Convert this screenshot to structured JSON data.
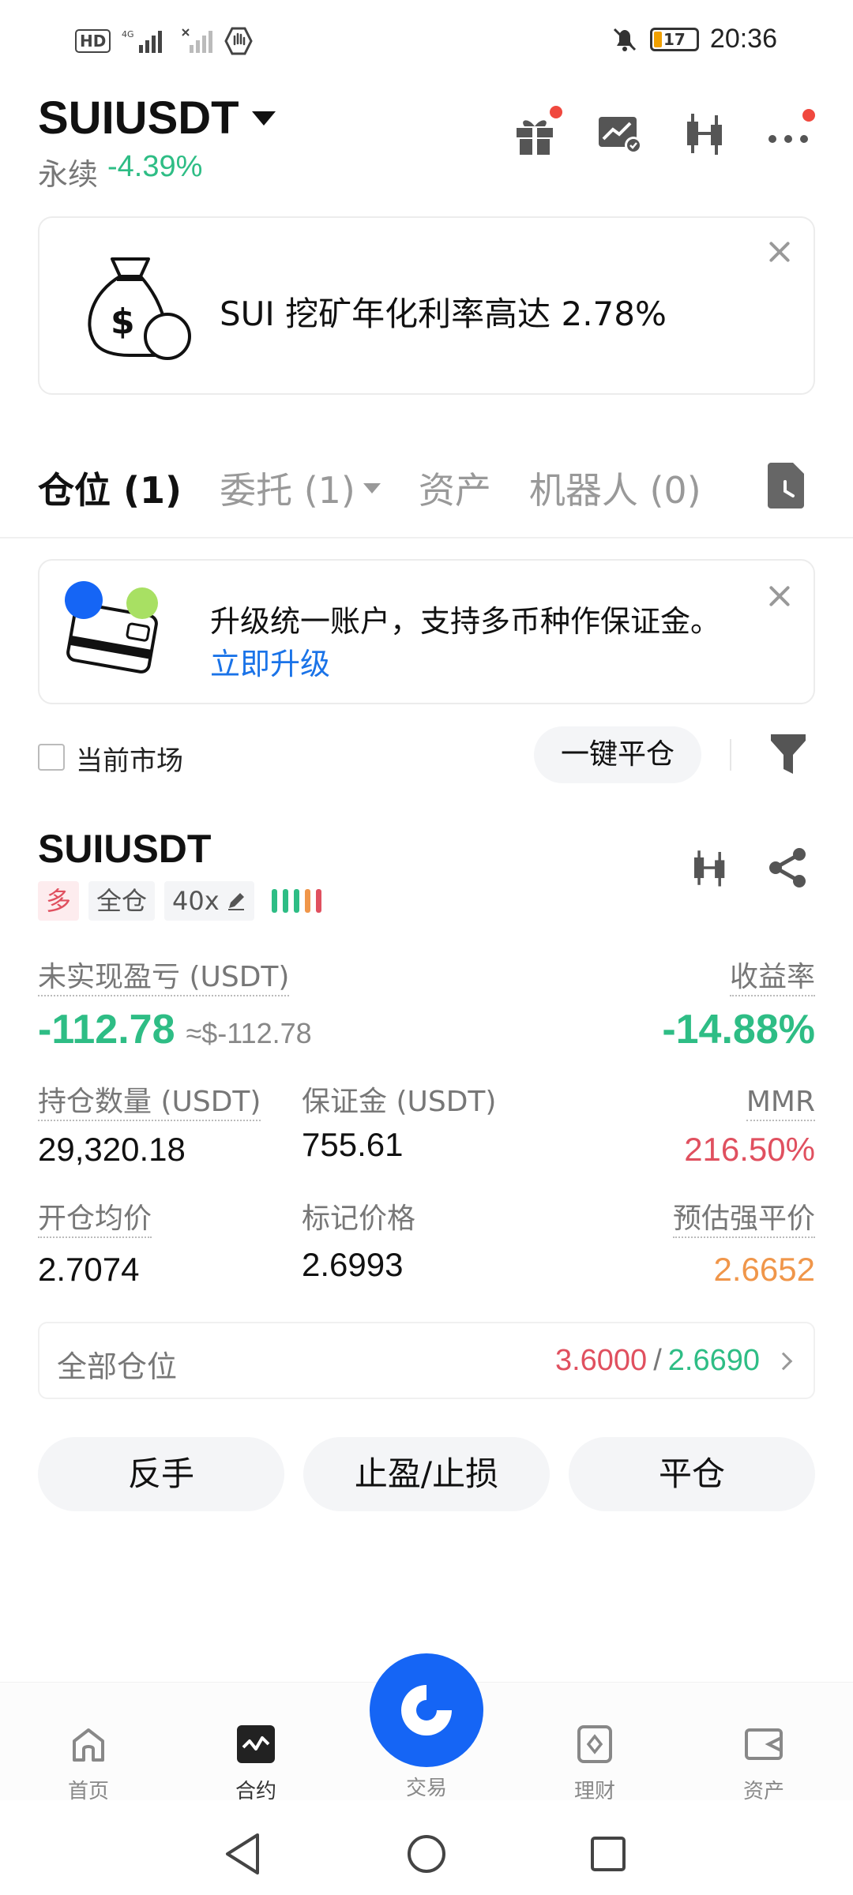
{
  "status_bar": {
    "time": "20:36",
    "battery": "17",
    "network": "HD",
    "signal": "4G"
  },
  "header": {
    "symbol": "SUIUSDT",
    "contract_type": "永续",
    "change": "-4.39%"
  },
  "promo": {
    "text": "SUI 挖矿年化利率高达 2.78%"
  },
  "tabs": [
    {
      "label": "仓位 (1)"
    },
    {
      "label": "委托 (1)"
    },
    {
      "label": "资产"
    },
    {
      "label": "机器人 (0)"
    }
  ],
  "upgrade": {
    "text": "升级统一账户，支持多币种作保证金。",
    "link": "立即升级"
  },
  "filter": {
    "current_market_label": "当前市场",
    "close_all_label": "一键平仓"
  },
  "position": {
    "symbol": "SUIUSDT",
    "side_tag": "多",
    "margin_mode_tag": "全仓",
    "leverage_tag": "40x",
    "unrealized_pnl_label": "未实现盈亏 (USDT)",
    "unrealized_pnl": "-112.78",
    "unrealized_pnl_usd": "≈$-112.78",
    "roi_label": "收益率",
    "roi": "-14.88%",
    "size_label": "持仓数量 (USDT)",
    "size": "29,320.18",
    "margin_label": "保证金 (USDT)",
    "margin": "755.61",
    "mmr_label": "MMR",
    "mmr": "216.50%",
    "entry_price_label": "开仓均价",
    "entry_price": "2.7074",
    "mark_price_label": "标记价格",
    "mark_price": "2.6993",
    "liq_price_label": "预估强平价",
    "liq_price": "2.6652"
  },
  "all_positions": {
    "label": "全部仓位",
    "value_high": "3.6000",
    "separator": "/",
    "value_low": "2.6690"
  },
  "actions": {
    "reverse": "反手",
    "tp_sl": "止盈/止损",
    "close": "平仓"
  },
  "bottom_nav": {
    "home": "首页",
    "futures": "合约",
    "trade": "交易",
    "earn": "理财",
    "assets": "资产"
  },
  "colors": {
    "green": "#2ebd85",
    "red": "#e0505f",
    "orange": "#f0964a",
    "brand_blue": "#1565f5",
    "link_blue": "#1a73e8"
  }
}
